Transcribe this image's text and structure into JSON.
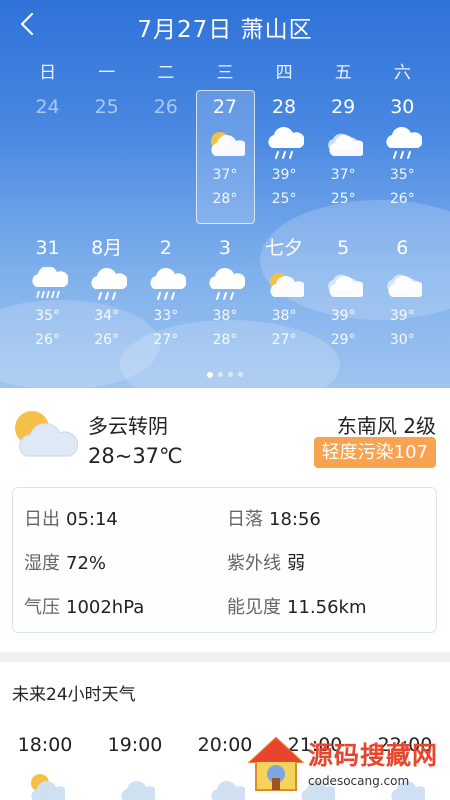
{
  "header": {
    "title": "7月27日 萧山区"
  },
  "weekdays": [
    "日",
    "一",
    "二",
    "三",
    "四",
    "五",
    "六"
  ],
  "week1": [
    {
      "day": "24",
      "past": true,
      "icon": "",
      "high": "",
      "low": ""
    },
    {
      "day": "25",
      "past": true,
      "icon": "",
      "high": "",
      "low": ""
    },
    {
      "day": "26",
      "past": true,
      "icon": "",
      "high": "",
      "low": ""
    },
    {
      "day": "27",
      "past": false,
      "icon": "partly-cloudy-icon",
      "high": "37°",
      "low": "28°"
    },
    {
      "day": "28",
      "past": false,
      "icon": "rain-icon",
      "high": "39°",
      "low": "25°"
    },
    {
      "day": "29",
      "past": false,
      "icon": "cloudy-icon",
      "high": "37°",
      "low": "25°"
    },
    {
      "day": "30",
      "past": false,
      "icon": "rain-icon",
      "high": "35°",
      "low": "26°"
    }
  ],
  "week2": [
    {
      "day": "31",
      "icon": "heavy-rain-icon",
      "high": "35°",
      "low": "26°"
    },
    {
      "day": "8月",
      "icon": "rain-icon",
      "high": "34°",
      "low": "26°"
    },
    {
      "day": "2",
      "icon": "rain-icon",
      "high": "33°",
      "low": "27°"
    },
    {
      "day": "3",
      "icon": "rain-icon",
      "high": "38°",
      "low": "28°"
    },
    {
      "day": "七夕",
      "icon": "partly-cloudy-icon",
      "high": "38°",
      "low": "27°"
    },
    {
      "day": "5",
      "icon": "cloudy-icon",
      "high": "39°",
      "low": "29°"
    },
    {
      "day": "6",
      "icon": "cloudy-icon",
      "high": "39°",
      "low": "30°"
    }
  ],
  "today": {
    "condition": "多云转阴",
    "temp_range": "28~37℃",
    "wind": "东南风 2级",
    "aqi": "轻度污染107",
    "icon": "partly-cloudy-icon"
  },
  "details": {
    "sunrise_label": "日出",
    "sunrise": "05:14",
    "sunset_label": "日落",
    "sunset": "18:56",
    "humidity_label": "湿度",
    "humidity": "72%",
    "uv_label": "紫外线",
    "uv": "弱",
    "pressure_label": "气压",
    "pressure": "1002hPa",
    "visibility_label": "能见度",
    "visibility": "11.56km"
  },
  "hourly": {
    "title": "未来24小时天气",
    "items": [
      {
        "time": "18:00",
        "icon": "partly-cloudy-icon"
      },
      {
        "time": "19:00",
        "icon": "cloudy-icon"
      },
      {
        "time": "20:00",
        "icon": "cloudy-icon"
      },
      {
        "time": "21:00",
        "icon": "cloudy-icon"
      },
      {
        "time": "22:00",
        "icon": "cloudy-icon"
      }
    ]
  },
  "watermark": {
    "text": "源码搜藏网",
    "url": "codesocang.com"
  },
  "colors": {
    "hero_top": "#2f72d8",
    "hero_bottom": "#9fc4f0",
    "aqi_badge": "#f7a350",
    "sun": "#f5c04a"
  },
  "pager": {
    "pages": 4,
    "active": 1
  }
}
